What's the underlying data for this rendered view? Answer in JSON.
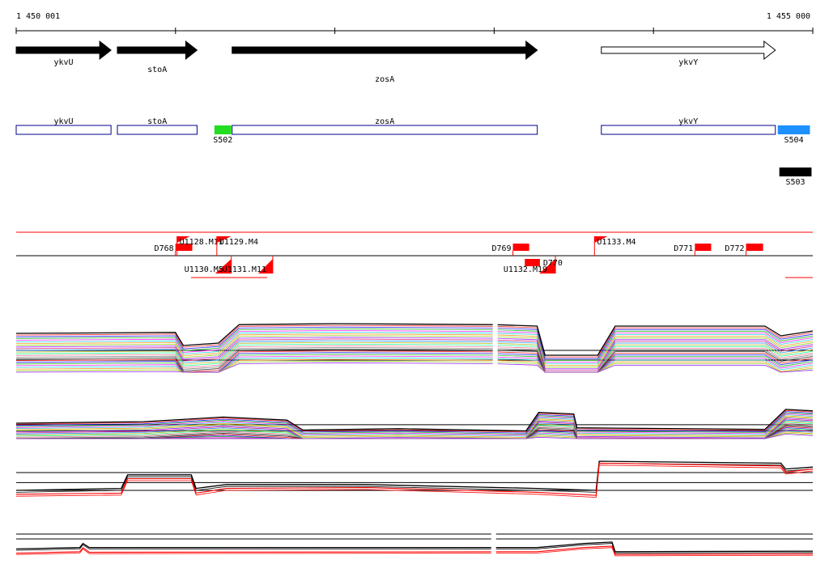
{
  "coordinates": {
    "start_label": "1 450 001",
    "end_label": "1 455 000",
    "start": 1450001,
    "end": 1455000
  },
  "genes": [
    {
      "name": "ykvU",
      "start": 1450001,
      "end": 1450596,
      "strand": "+",
      "filled": true,
      "label_row": 1
    },
    {
      "name": "stoA",
      "start": 1450636,
      "end": 1451136,
      "strand": "+",
      "filled": true,
      "label_row": 2
    },
    {
      "name": "zosA",
      "start": 1451356,
      "end": 1453271,
      "strand": "+",
      "filled": true,
      "label_row": 3
    },
    {
      "name": "ykvY",
      "start": 1453673,
      "end": 1454765,
      "strand": "+",
      "filled": false,
      "label_row": 1
    }
  ],
  "features": [
    {
      "name": "ykvU",
      "start": 1450001,
      "end": 1450596
    },
    {
      "name": "stoA",
      "start": 1450636,
      "end": 1451136
    },
    {
      "name": "zosA",
      "start": 1451356,
      "end": 1453271
    },
    {
      "name": "ykvY",
      "start": 1453673,
      "end": 1454765
    }
  ],
  "segments": [
    {
      "name": "S502",
      "start": 1451245,
      "end": 1451351,
      "color": "#22dd22"
    },
    {
      "name": "S504",
      "start": 1454780,
      "end": 1454982,
      "color": "#1e90ff"
    },
    {
      "name": "S503",
      "start": 1454790,
      "end": 1454992,
      "color": "#000000"
    }
  ],
  "upper_labels": [
    {
      "name": "D768",
      "start": 1451000,
      "end": 1451106,
      "color": "#ff0000"
    },
    {
      "name": "U1128.M11",
      "start": 1451010,
      "end": 1451091,
      "color": "#ff0000",
      "kind": "flag"
    },
    {
      "name": "U1129.M4",
      "start": 1451260,
      "end": 1451351,
      "color": "#ff0000",
      "kind": "flag"
    },
    {
      "name": "D769",
      "start": 1453118,
      "end": 1453220,
      "color": "#ff0000"
    },
    {
      "name": "U1133.M4",
      "start": 1453630,
      "end": 1453712,
      "color": "#ff0000",
      "kind": "flag"
    },
    {
      "name": "D771",
      "start": 1454260,
      "end": 1454362,
      "color": "#ff0000"
    },
    {
      "name": "D772",
      "start": 1454581,
      "end": 1454688,
      "color": "#ff0000"
    }
  ],
  "lower_labels": [
    {
      "name": "U1130.M5",
      "start": 1451250,
      "end": 1451351,
      "color": "#ff0000"
    },
    {
      "name": "U1131.M11",
      "start": 1451520,
      "end": 1451611,
      "color": "#ff0000"
    },
    {
      "name": "U1132.M19",
      "start": 1453283,
      "end": 1453385,
      "color": "#ff0000"
    },
    {
      "name": "D770",
      "start": 1453345,
      "end": 1453440,
      "color": "#ff0000"
    }
  ],
  "palette": [
    "#000000",
    "#ff0000",
    "#0000ff",
    "#00aa00",
    "#ff00ff",
    "#00cccc",
    "#ff8800",
    "#88cc00",
    "#8800ff",
    "#cc0066",
    "#0088ff",
    "#aaaa00",
    "#00ff88",
    "#ff6688",
    "#666666"
  ],
  "panels": [
    {
      "id": "panel-1",
      "break_at": 1453007,
      "profiles": [
        {
          "name": "top-profile",
          "color": "#000000",
          "points": [
            [
              1450001,
              0.8
            ],
            [
              1451000,
              0.82
            ],
            [
              1451050,
              0.55
            ],
            [
              1451270,
              0.6
            ],
            [
              1451400,
              0.98
            ],
            [
              1452000,
              1.0
            ],
            [
              1453000,
              0.98
            ],
            [
              1453270,
              0.95
            ],
            [
              1453320,
              0.35
            ],
            [
              1453650,
              0.35
            ],
            [
              1453760,
              0.95
            ],
            [
              1454700,
              0.95
            ],
            [
              1454800,
              0.75
            ],
            [
              1455000,
              0.85
            ]
          ]
        }
      ]
    },
    {
      "id": "panel-2",
      "break_at": null,
      "profiles": [
        {
          "name": "top-profile",
          "color": "#000000",
          "points": [
            [
              1450001,
              0.5
            ],
            [
              1450800,
              0.55
            ],
            [
              1451300,
              0.7
            ],
            [
              1451700,
              0.6
            ],
            [
              1451800,
              0.28
            ],
            [
              1452400,
              0.32
            ],
            [
              1453200,
              0.25
            ],
            [
              1453280,
              0.85
            ],
            [
              1453500,
              0.8
            ],
            [
              1453520,
              0.35
            ],
            [
              1454700,
              0.3
            ],
            [
              1454830,
              0.95
            ],
            [
              1455000,
              0.9
            ]
          ]
        }
      ]
    },
    {
      "id": "panel-3",
      "break_at": null,
      "profiles": [
        {
          "name": "black-a",
          "color": "#000000",
          "points": [
            [
              1450001,
              0.25
            ],
            [
              1450660,
              0.3
            ],
            [
              1450700,
              0.65
            ],
            [
              1451100,
              0.65
            ],
            [
              1451130,
              0.3
            ],
            [
              1451320,
              0.4
            ],
            [
              1452200,
              0.4
            ],
            [
              1453270,
              0.3
            ],
            [
              1453640,
              0.25
            ],
            [
              1453660,
              1.0
            ],
            [
              1454800,
              0.95
            ],
            [
              1454830,
              0.8
            ],
            [
              1455000,
              0.85
            ]
          ]
        },
        {
          "name": "red-a",
          "color": "#ff0000",
          "points": [
            [
              1450001,
              0.15
            ],
            [
              1450660,
              0.18
            ],
            [
              1450700,
              0.55
            ],
            [
              1451100,
              0.55
            ],
            [
              1451130,
              0.18
            ],
            [
              1451320,
              0.3
            ],
            [
              1452200,
              0.32
            ],
            [
              1453270,
              0.2
            ],
            [
              1453640,
              0.12
            ],
            [
              1453660,
              0.95
            ],
            [
              1454800,
              0.88
            ],
            [
              1454830,
              0.72
            ],
            [
              1455000,
              0.8
            ]
          ]
        }
      ]
    },
    {
      "id": "panel-4",
      "break_at": 1452997,
      "profiles": [
        {
          "name": "black-a",
          "color": "#000000",
          "points": [
            [
              1450001,
              0.4
            ],
            [
              1450400,
              0.45
            ],
            [
              1450420,
              0.6
            ],
            [
              1450460,
              0.45
            ],
            [
              1453270,
              0.45
            ],
            [
              1453560,
              0.6
            ],
            [
              1453740,
              0.65
            ],
            [
              1453760,
              0.3
            ],
            [
              1455000,
              0.32
            ]
          ]
        },
        {
          "name": "red-a",
          "color": "#ff0000",
          "points": [
            [
              1450001,
              0.25
            ],
            [
              1450400,
              0.3
            ],
            [
              1450420,
              0.45
            ],
            [
              1450460,
              0.28
            ],
            [
              1453270,
              0.3
            ],
            [
              1453560,
              0.45
            ],
            [
              1453740,
              0.5
            ],
            [
              1453760,
              0.2
            ],
            [
              1455000,
              0.22
            ]
          ]
        }
      ]
    }
  ]
}
